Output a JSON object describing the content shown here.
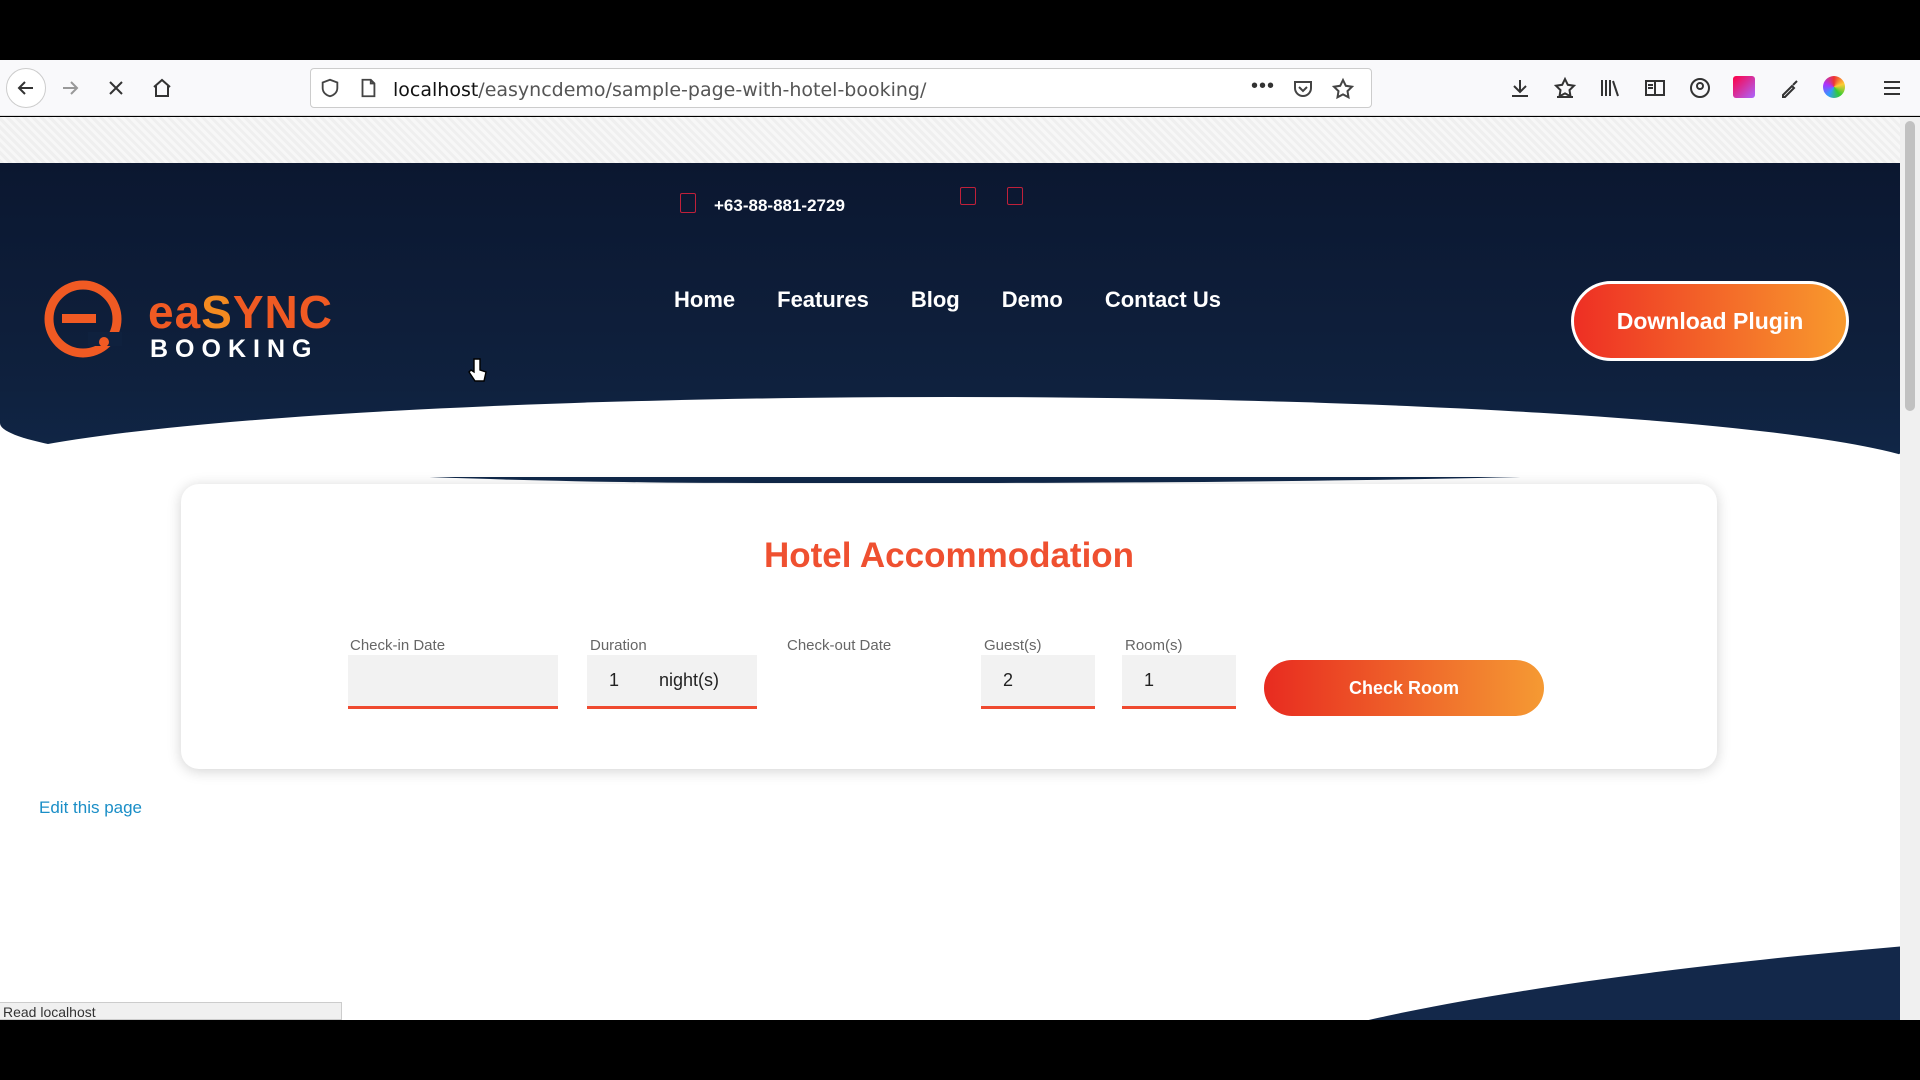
{
  "browser": {
    "url_host": "localhost",
    "url_path": "/easyncdemo/sample-page-with-hotel-booking/",
    "url_more": "•••",
    "status_text": "Read localhost"
  },
  "header": {
    "phone": "+63-88-881-2729",
    "logo_main_a": "ea",
    "logo_main_s": "S",
    "logo_main_b": "YNC",
    "logo_sub": "BOOKING",
    "nav": [
      "Home",
      "Features",
      "Blog",
      "Demo",
      "Contact Us"
    ],
    "download_label": "Download Plugin"
  },
  "booking": {
    "title": "Hotel Accommodation",
    "checkin_label": "Check-in Date",
    "checkin_value": "",
    "duration_label": "Duration",
    "duration_value": "1",
    "duration_suffix": "night(s)",
    "checkout_label": "Check-out Date",
    "guests_label": "Guest(s)",
    "guests_value": "2",
    "rooms_label": "Room(s)",
    "rooms_value": "1",
    "check_button": "Check Room"
  },
  "footer": {
    "edit_link": "Edit this page"
  },
  "colors": {
    "accent": "#ef5030",
    "nav_bg": "#0b1730",
    "link": "#1a8ec7"
  }
}
